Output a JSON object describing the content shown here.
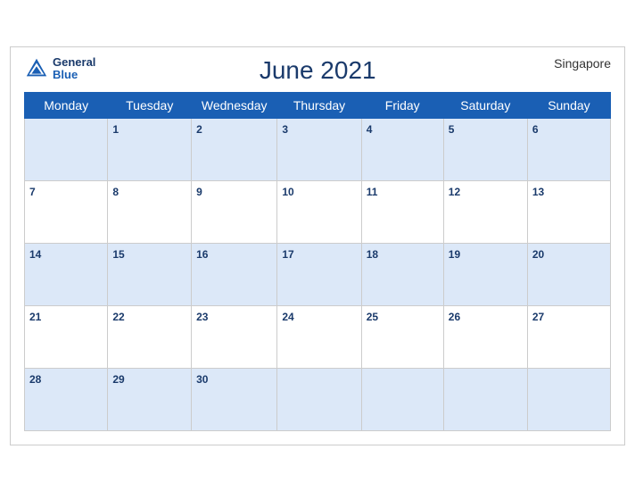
{
  "header": {
    "title": "June 2021",
    "location": "Singapore",
    "logo_line1": "General",
    "logo_line2": "Blue"
  },
  "weekdays": [
    "Monday",
    "Tuesday",
    "Wednesday",
    "Thursday",
    "Friday",
    "Saturday",
    "Sunday"
  ],
  "weeks": [
    [
      null,
      1,
      2,
      3,
      4,
      5,
      6
    ],
    [
      7,
      8,
      9,
      10,
      11,
      12,
      13
    ],
    [
      14,
      15,
      16,
      17,
      18,
      19,
      20
    ],
    [
      21,
      22,
      23,
      24,
      25,
      26,
      27
    ],
    [
      28,
      29,
      30,
      null,
      null,
      null,
      null
    ]
  ]
}
